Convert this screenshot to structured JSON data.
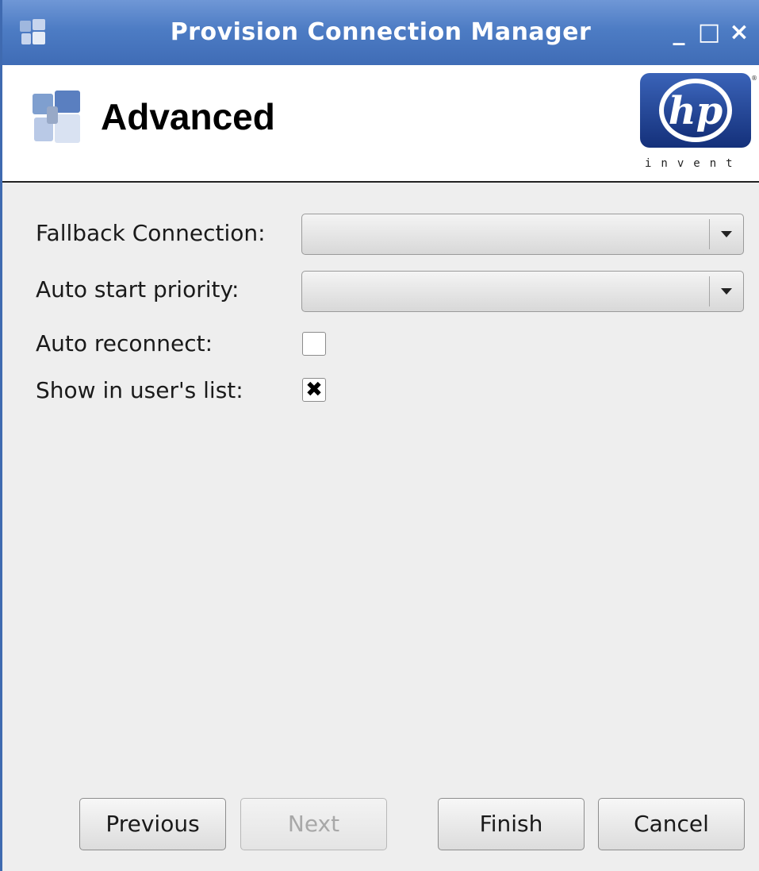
{
  "window": {
    "title": "Provision Connection Manager",
    "controls": {
      "minimize": "_",
      "maximize": "□",
      "close": "×"
    }
  },
  "header": {
    "title": "Advanced",
    "logo": {
      "brand": "hp",
      "tagline": "invent",
      "registered": "®"
    }
  },
  "form": {
    "fallback_connection": {
      "label": "Fallback Connection:",
      "value": ""
    },
    "auto_start_priority": {
      "label": "Auto start priority:",
      "value": ""
    },
    "auto_reconnect": {
      "label": "Auto reconnect:",
      "checked": false
    },
    "show_in_users_list": {
      "label": "Show in user's list:",
      "checked": true,
      "mark": "✖"
    }
  },
  "buttons": {
    "previous": "Previous",
    "next": "Next",
    "finish": "Finish",
    "cancel": "Cancel"
  },
  "colors": {
    "titlebar": "#4d7cc4",
    "hp_blue": "#1c3d8f"
  }
}
